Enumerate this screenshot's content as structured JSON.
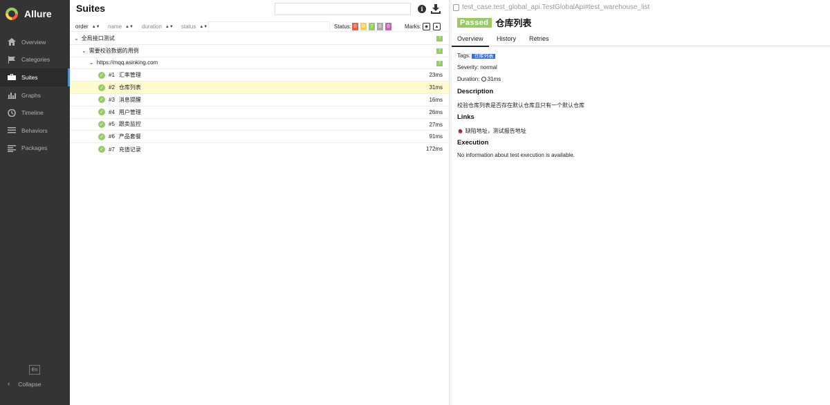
{
  "app": {
    "name": "Allure"
  },
  "sidebar": {
    "items": [
      {
        "label": "Overview",
        "icon": "home-icon"
      },
      {
        "label": "Categories",
        "icon": "flag-icon"
      },
      {
        "label": "Suites",
        "icon": "briefcase-icon",
        "active": true
      },
      {
        "label": "Graphs",
        "icon": "bar-chart-icon"
      },
      {
        "label": "Timeline",
        "icon": "clock-icon"
      },
      {
        "label": "Behaviors",
        "icon": "list-icon"
      },
      {
        "label": "Packages",
        "icon": "align-left-icon"
      }
    ],
    "language": "En",
    "collapse_label": "Collapse"
  },
  "suites": {
    "title": "Suites",
    "sort_columns": [
      "order",
      "name",
      "duration",
      "status"
    ],
    "status_label": "Status:",
    "status_counts": [
      {
        "value": "0",
        "color": "#fd5a3e"
      },
      {
        "value": "0",
        "color": "#ffd050"
      },
      {
        "value": "7",
        "color": "#97cc64"
      },
      {
        "value": "0",
        "color": "#aaaaaa"
      },
      {
        "value": "0",
        "color": "#d35ebe"
      }
    ],
    "marks_label": "Marks:",
    "groups": [
      {
        "name": "全局接口测试",
        "count": "7"
      },
      {
        "name": "需要校验数据的用例",
        "count": "7"
      },
      {
        "name": "https://mqq.asinking.com",
        "count": "7"
      }
    ],
    "tests": [
      {
        "num": "#1",
        "name": "汇率管理",
        "duration": "23ms"
      },
      {
        "num": "#2",
        "name": "仓库列表",
        "duration": "31ms",
        "selected": true
      },
      {
        "num": "#3",
        "name": "消息提醒",
        "duration": "16ms"
      },
      {
        "num": "#4",
        "name": "用户管理",
        "duration": "26ms"
      },
      {
        "num": "#5",
        "name": "跟卖监控",
        "duration": "27ms"
      },
      {
        "num": "#6",
        "name": "产品套餐",
        "duration": "91ms"
      },
      {
        "num": "#7",
        "name": "充值记录",
        "duration": "172ms"
      }
    ]
  },
  "detail": {
    "breadcrumb": "test_case.test_global_api.TestGlobalApi#test_warehouse_list",
    "status": "Passed",
    "title": "仓库列表",
    "tabs": [
      "Overview",
      "History",
      "Retries"
    ],
    "tags_label": "Tags:",
    "tag": "仓库列表",
    "severity": "Severity: normal",
    "duration_label": "Duration:",
    "duration": "31ms",
    "description_heading": "Description",
    "description": "校验仓库列表是否存在默认仓库且只有一个默认仓库",
    "links_heading": "Links",
    "links": "缺陷地址，测试报告地址",
    "execution_heading": "Execution",
    "execution_text": "No information about test execution is available."
  },
  "colors": {
    "passed": "#97cc64",
    "sidebar_bg": "#343434",
    "accent": "#4a90d9",
    "tag": "#3b6fd8",
    "selected_row": "#fffbcf"
  }
}
